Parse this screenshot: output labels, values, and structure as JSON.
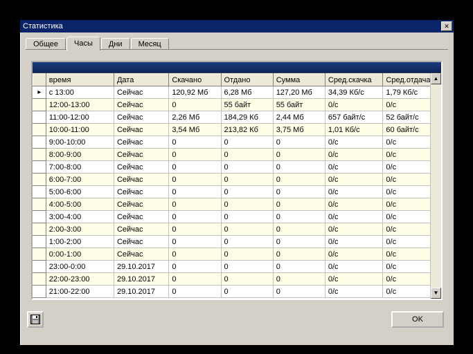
{
  "window": {
    "title": "Статистика"
  },
  "tabs": [
    {
      "label": "Общее",
      "active": false
    },
    {
      "label": "Часы",
      "active": true
    },
    {
      "label": "Дни",
      "active": false
    },
    {
      "label": "Месяц",
      "active": false
    }
  ],
  "columns": [
    "",
    "время",
    "Дата",
    "Скачано",
    "Отдано",
    "Сумма",
    "Сред.скачка",
    "Сред.отдача"
  ],
  "rows": [
    {
      "selected": true,
      "time": "c 13:00",
      "date": "Сейчас",
      "down": "120,92 Мб",
      "up": "6,28 Мб",
      "sum": "127,20 Мб",
      "sd": "34,39 Кб/c",
      "su": "1,79 Кб/c"
    },
    {
      "selected": false,
      "time": "12:00-13:00",
      "date": "Сейчас",
      "down": "0",
      "up": "55 байт",
      "sum": "55 байт",
      "sd": "0/c",
      "su": "0/c"
    },
    {
      "selected": false,
      "time": "11:00-12:00",
      "date": "Сейчас",
      "down": "2,26 Мб",
      "up": "184,29 Кб",
      "sum": "2,44 Мб",
      "sd": "657 байт/c",
      "su": "52 байт/c"
    },
    {
      "selected": false,
      "time": "10:00-11:00",
      "date": "Сейчас",
      "down": "3,54 Мб",
      "up": "213,82 Кб",
      "sum": "3,75 Мб",
      "sd": "1,01 Кб/c",
      "su": "60 байт/c"
    },
    {
      "selected": false,
      "time": "9:00-10:00",
      "date": "Сейчас",
      "down": "0",
      "up": "0",
      "sum": "0",
      "sd": "0/c",
      "su": "0/c"
    },
    {
      "selected": false,
      "time": "8:00-9:00",
      "date": "Сейчас",
      "down": "0",
      "up": "0",
      "sum": "0",
      "sd": "0/c",
      "su": "0/c"
    },
    {
      "selected": false,
      "time": "7:00-8:00",
      "date": "Сейчас",
      "down": "0",
      "up": "0",
      "sum": "0",
      "sd": "0/c",
      "su": "0/c"
    },
    {
      "selected": false,
      "time": "6:00-7:00",
      "date": "Сейчас",
      "down": "0",
      "up": "0",
      "sum": "0",
      "sd": "0/c",
      "su": "0/c"
    },
    {
      "selected": false,
      "time": "5:00-6:00",
      "date": "Сейчас",
      "down": "0",
      "up": "0",
      "sum": "0",
      "sd": "0/c",
      "su": "0/c"
    },
    {
      "selected": false,
      "time": "4:00-5:00",
      "date": "Сейчас",
      "down": "0",
      "up": "0",
      "sum": "0",
      "sd": "0/c",
      "su": "0/c"
    },
    {
      "selected": false,
      "time": "3:00-4:00",
      "date": "Сейчас",
      "down": "0",
      "up": "0",
      "sum": "0",
      "sd": "0/c",
      "su": "0/c"
    },
    {
      "selected": false,
      "time": "2:00-3:00",
      "date": "Сейчас",
      "down": "0",
      "up": "0",
      "sum": "0",
      "sd": "0/c",
      "su": "0/c"
    },
    {
      "selected": false,
      "time": "1:00-2:00",
      "date": "Сейчас",
      "down": "0",
      "up": "0",
      "sum": "0",
      "sd": "0/c",
      "su": "0/c"
    },
    {
      "selected": false,
      "time": "0:00-1:00",
      "date": "Сейчас",
      "down": "0",
      "up": "0",
      "sum": "0",
      "sd": "0/c",
      "su": "0/c"
    },
    {
      "selected": false,
      "time": "23:00-0:00",
      "date": "29.10.2017",
      "down": "0",
      "up": "0",
      "sum": "0",
      "sd": "0/c",
      "su": "0/c"
    },
    {
      "selected": false,
      "time": "22:00-23:00",
      "date": "29.10.2017",
      "down": "0",
      "up": "0",
      "sum": "0",
      "sd": "0/c",
      "su": "0/c"
    },
    {
      "selected": false,
      "time": "21:00-22:00",
      "date": "29.10.2017",
      "down": "0",
      "up": "0",
      "sum": "0",
      "sd": "0/c",
      "su": "0/c"
    }
  ],
  "footer": {
    "ok": "OK"
  }
}
